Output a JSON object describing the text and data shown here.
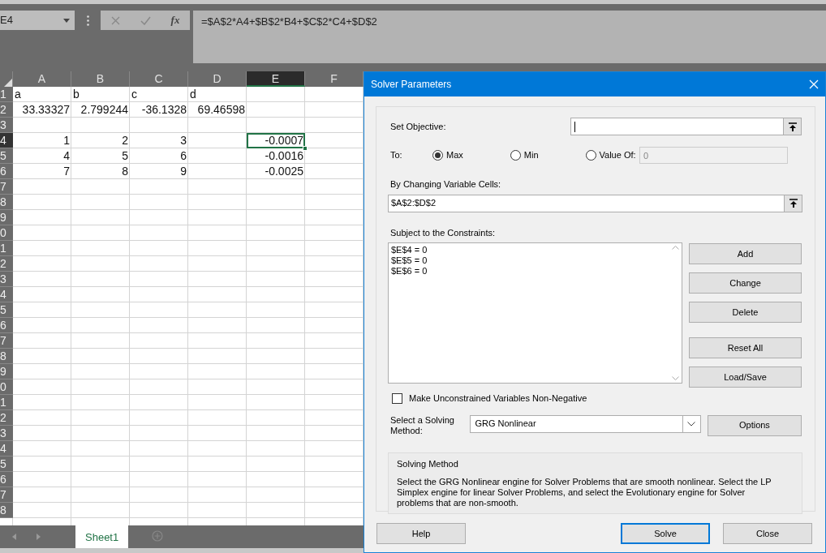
{
  "name_box": {
    "value": "E4"
  },
  "formula_bar": {
    "function_label": "fx",
    "value": "=$A$2*A4+$B$2*B4+$C$2*C4+$D$2"
  },
  "sheet": {
    "columns": [
      {
        "label": "A",
        "selected": false
      },
      {
        "label": "B",
        "selected": false
      },
      {
        "label": "C",
        "selected": false
      },
      {
        "label": "D",
        "selected": false
      },
      {
        "label": "E",
        "selected": true
      },
      {
        "label": "F",
        "selected": false
      }
    ],
    "rows": [
      {
        "label": "1",
        "selected": false,
        "cells": [
          {
            "text": "a",
            "kind": "text",
            "selected": false
          },
          {
            "text": "b",
            "kind": "text",
            "selected": false
          },
          {
            "text": "c",
            "kind": "text",
            "selected": false
          },
          {
            "text": "d",
            "kind": "text",
            "selected": false
          },
          null,
          null
        ]
      },
      {
        "label": "2",
        "selected": false,
        "cells": [
          {
            "text": "33.33327",
            "kind": "number",
            "selected": false
          },
          {
            "text": "2.799244",
            "kind": "number",
            "selected": false
          },
          {
            "text": "-36.1328",
            "kind": "number",
            "selected": false
          },
          {
            "text": "69.46598",
            "kind": "number",
            "selected": false
          },
          null,
          null
        ]
      },
      {
        "label": "3",
        "selected": false
      },
      {
        "label": "4",
        "selected": true,
        "cells": [
          {
            "text": "1",
            "kind": "number",
            "selected": false
          },
          {
            "text": "2",
            "kind": "number",
            "selected": false
          },
          {
            "text": "3",
            "kind": "number",
            "selected": false
          },
          null,
          {
            "text": "-0.0007",
            "kind": "number",
            "selected": true
          },
          null
        ]
      },
      {
        "label": "5",
        "selected": false,
        "cells": [
          {
            "text": "4",
            "kind": "number",
            "selected": false
          },
          {
            "text": "5",
            "kind": "number",
            "selected": false
          },
          {
            "text": "6",
            "kind": "number",
            "selected": false
          },
          null,
          {
            "text": "-0.0016",
            "kind": "number",
            "selected": false
          },
          null
        ]
      },
      {
        "label": "6",
        "selected": false,
        "cells": [
          {
            "text": "7",
            "kind": "number",
            "selected": false
          },
          {
            "text": "8",
            "kind": "number",
            "selected": false
          },
          {
            "text": "9",
            "kind": "number",
            "selected": false
          },
          null,
          {
            "text": "-0.0025",
            "kind": "number",
            "selected": false
          },
          null
        ]
      },
      {
        "label": "7",
        "selected": false
      },
      {
        "label": "8",
        "selected": false
      },
      {
        "label": "9",
        "selected": false
      },
      {
        "label": "0",
        "selected": false
      },
      {
        "label": "1",
        "selected": false
      },
      {
        "label": "2",
        "selected": false
      },
      {
        "label": "3",
        "selected": false
      },
      {
        "label": "4",
        "selected": false
      },
      {
        "label": "5",
        "selected": false
      },
      {
        "label": "6",
        "selected": false
      },
      {
        "label": "7",
        "selected": false
      },
      {
        "label": "8",
        "selected": false
      },
      {
        "label": "9",
        "selected": false
      },
      {
        "label": "0",
        "selected": false
      },
      {
        "label": "1",
        "selected": false
      },
      {
        "label": "2",
        "selected": false
      },
      {
        "label": "3",
        "selected": false
      },
      {
        "label": "4",
        "selected": false
      },
      {
        "label": "5",
        "selected": false
      },
      {
        "label": "6",
        "selected": false
      },
      {
        "label": "7",
        "selected": false
      },
      {
        "label": "8",
        "selected": false
      }
    ]
  },
  "sheet_tabs": [
    {
      "label": "Sheet1",
      "selected": true
    }
  ],
  "dialog": {
    "title": "Solver Parameters",
    "objective": {
      "label": "Set Objective:"
    },
    "to": {
      "label": "To:",
      "options": [
        {
          "label": "Max",
          "selected": true
        },
        {
          "label": "Min",
          "selected": false
        },
        {
          "label": "Value Of:",
          "selected": false
        }
      ],
      "value_field": {
        "value": "0",
        "disabled": true
      }
    },
    "variable_cells": {
      "label": "By Changing Variable Cells:",
      "value": "$A$2:$D$2"
    },
    "constraints": {
      "label": "Subject to the Constraints:",
      "items": [
        "$E$4 = 0",
        "$E$5 = 0",
        "$E$6 = 0"
      ]
    },
    "constraint_buttons": [
      "Add",
      "Change",
      "Delete",
      "Reset All",
      "Load/Save"
    ],
    "nonnegative": {
      "label": "Make Unconstrained Variables Non-Negative",
      "checked": false
    },
    "method": {
      "label": "Select a Solving Method:",
      "value": "GRG Nonlinear"
    },
    "options_button": "Options",
    "description": {
      "title": "Solving Method",
      "text": "Select the GRG Nonlinear engine for Solver Problems that are smooth nonlinear. Select the LP Simplex engine for linear Solver Problems, and select the Evolutionary engine for Solver problems that are non-smooth."
    },
    "footer_buttons": [
      {
        "label": "Help",
        "default": false
      },
      {
        "label": "Solve",
        "default": true
      },
      {
        "label": "Close",
        "default": false
      }
    ]
  }
}
